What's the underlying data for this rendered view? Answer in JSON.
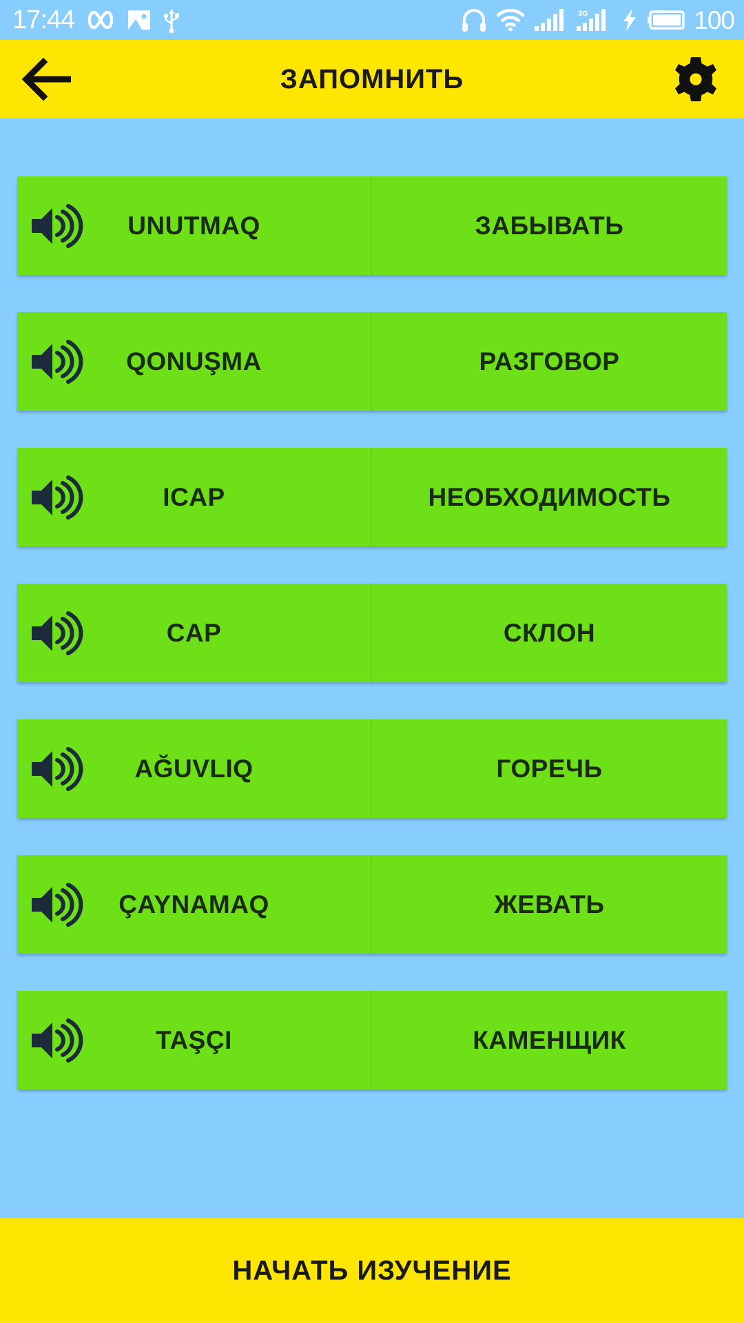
{
  "colors": {
    "status_bar_bg": "#87ceff",
    "header_bg": "#ffe600",
    "body_bg": "#87ceff",
    "row_bg": "#6ee017",
    "row_text": "#1b2a12",
    "header_text": "#1a1a1a",
    "status_icon": "#ffffff"
  },
  "status_bar": {
    "time": "17:44",
    "battery_percent": "100",
    "left_icons": [
      "infinity-icon",
      "image-icon",
      "usb-icon"
    ],
    "right_icons": [
      "headphones-icon",
      "wifi-icon",
      "signal-bars-icon",
      "signal-3g-icon",
      "charging-bolt-icon",
      "battery-icon"
    ],
    "network_label": "3G"
  },
  "header": {
    "back_label": "back-arrow-icon",
    "title": "ЗАПОМНИТЬ",
    "settings_label": "gear-icon"
  },
  "word_pairs": [
    {
      "speaker": "speaker-icon",
      "source": "UNUTMAQ",
      "target": "ЗАБЫВАТЬ"
    },
    {
      "speaker": "speaker-icon",
      "source": "QONUŞMA",
      "target": "РАЗГОВОР"
    },
    {
      "speaker": "speaker-icon",
      "source": "ICAP",
      "target": "НЕОБХОДИМОСТЬ"
    },
    {
      "speaker": "speaker-icon",
      "source": "CAP",
      "target": "СКЛОН"
    },
    {
      "speaker": "speaker-icon",
      "source": "AĞUVLIQ",
      "target": "ГОРЕЧЬ"
    },
    {
      "speaker": "speaker-icon",
      "source": "ÇAYNAMAQ",
      "target": "ЖЕВАТЬ"
    },
    {
      "speaker": "speaker-icon",
      "source": "TAŞÇI",
      "target": "КАМЕНЩИК"
    }
  ],
  "bottom_bar": {
    "label": "НАЧАТЬ ИЗУЧЕНИЕ"
  }
}
